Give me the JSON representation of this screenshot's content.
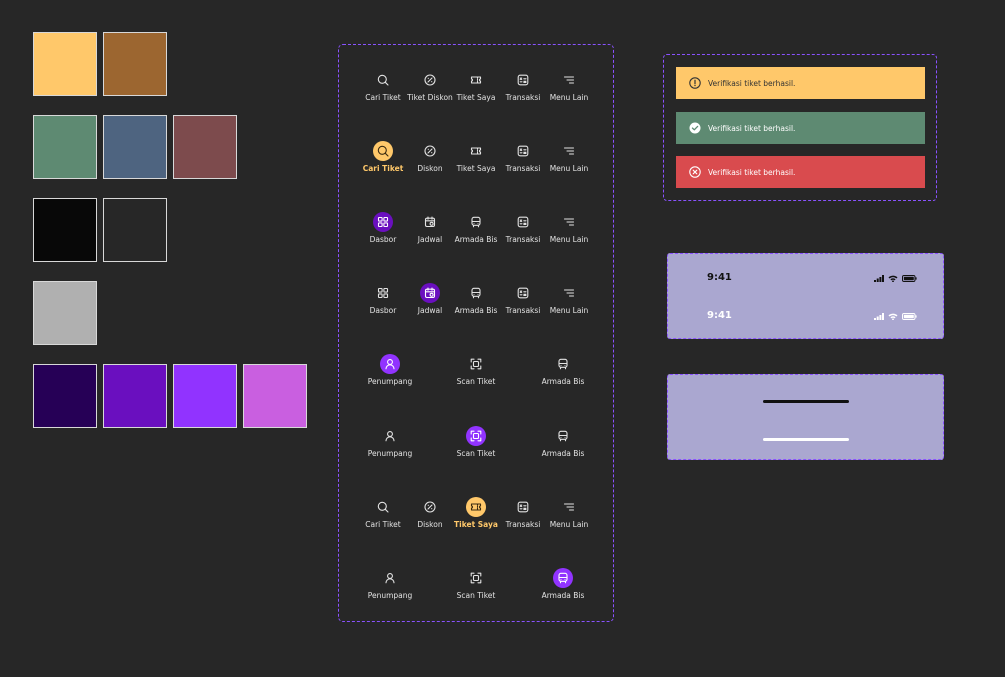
{
  "colors": {
    "yellow": "#ffc86a",
    "brown": "#9c6630",
    "green": "#5e8a72",
    "blue": "#4e6480",
    "maroon": "#7d4b4d",
    "black": "#080808",
    "charcoal": "#272727",
    "gray": "#b0b0b0",
    "deep_purple": "#260056",
    "purple": "#6a0fbf",
    "violet": "#9133ff",
    "orchid": "#c95fe0",
    "alert_error": "#d94b4e",
    "panel_lavender": "#aaa7d0",
    "accent_border": "#8a52ff"
  },
  "nav_rows": [
    {
      "items": [
        {
          "icon": "search-icon",
          "label": "Cari Tiket",
          "active": ""
        },
        {
          "icon": "discount-icon",
          "label": "Tiket Diskon",
          "active": ""
        },
        {
          "icon": "ticket-icon",
          "label": "Tiket Saya",
          "active": ""
        },
        {
          "icon": "transaction-icon",
          "label": "Transaksi",
          "active": ""
        },
        {
          "icon": "menu-icon",
          "label": "Menu Lain",
          "active": ""
        }
      ]
    },
    {
      "items": [
        {
          "icon": "search-icon",
          "label": "Cari Tiket",
          "active": "yellow"
        },
        {
          "icon": "discount-icon",
          "label": "Diskon",
          "active": ""
        },
        {
          "icon": "ticket-icon",
          "label": "Tiket Saya",
          "active": ""
        },
        {
          "icon": "transaction-icon",
          "label": "Transaksi",
          "active": ""
        },
        {
          "icon": "menu-icon",
          "label": "Menu Lain",
          "active": ""
        }
      ]
    },
    {
      "items": [
        {
          "icon": "dashboard-icon",
          "label": "Dasbor",
          "active": "purple-dark"
        },
        {
          "icon": "calendar-icon",
          "label": "Jadwal",
          "active": ""
        },
        {
          "icon": "bus-icon",
          "label": "Armada Bis",
          "active": ""
        },
        {
          "icon": "transaction-icon",
          "label": "Transaksi",
          "active": ""
        },
        {
          "icon": "menu-icon",
          "label": "Menu Lain",
          "active": ""
        }
      ]
    },
    {
      "items": [
        {
          "icon": "dashboard-icon",
          "label": "Dasbor",
          "active": ""
        },
        {
          "icon": "calendar-icon",
          "label": "Jadwal",
          "active": "purple-dark"
        },
        {
          "icon": "bus-icon",
          "label": "Armada Bis",
          "active": ""
        },
        {
          "icon": "transaction-icon",
          "label": "Transaksi",
          "active": ""
        },
        {
          "icon": "menu-icon",
          "label": "Menu Lain",
          "active": ""
        }
      ]
    },
    {
      "items": [
        {
          "icon": "user-icon",
          "label": "Penumpang",
          "active": "purple"
        },
        {
          "icon": "scan-icon",
          "label": "Scan Tiket",
          "active": ""
        },
        {
          "icon": "bus-icon",
          "label": "Armada Bis",
          "active": ""
        }
      ]
    },
    {
      "items": [
        {
          "icon": "user-icon",
          "label": "Penumpang",
          "active": ""
        },
        {
          "icon": "scan-icon",
          "label": "Scan Tiket",
          "active": "purple"
        },
        {
          "icon": "bus-icon",
          "label": "Armada Bis",
          "active": ""
        }
      ]
    },
    {
      "items": [
        {
          "icon": "search-icon",
          "label": "Cari Tiket",
          "active": ""
        },
        {
          "icon": "discount-icon",
          "label": "Diskon",
          "active": ""
        },
        {
          "icon": "ticket-icon",
          "label": "Tiket Saya",
          "active": "yellow"
        },
        {
          "icon": "transaction-icon",
          "label": "Transaksi",
          "active": ""
        },
        {
          "icon": "menu-icon",
          "label": "Menu Lain",
          "active": ""
        }
      ]
    },
    {
      "items": [
        {
          "icon": "user-icon",
          "label": "Penumpang",
          "active": ""
        },
        {
          "icon": "scan-icon",
          "label": "Scan Tiket",
          "active": ""
        },
        {
          "icon": "bus-icon",
          "label": "Armada Bis",
          "active": "purple"
        }
      ]
    }
  ],
  "alerts": [
    {
      "type": "warning",
      "icon": "warning-icon",
      "text": "Verifikasi tiket berhasil."
    },
    {
      "type": "success",
      "icon": "check-circle-icon",
      "text": "Verifikasi tiket berhasil."
    },
    {
      "type": "error",
      "icon": "close-circle-icon",
      "text": "Verifikasi tiket berhasil."
    }
  ],
  "status_bar": {
    "time_dark": "9:41",
    "time_light": "9:41"
  }
}
